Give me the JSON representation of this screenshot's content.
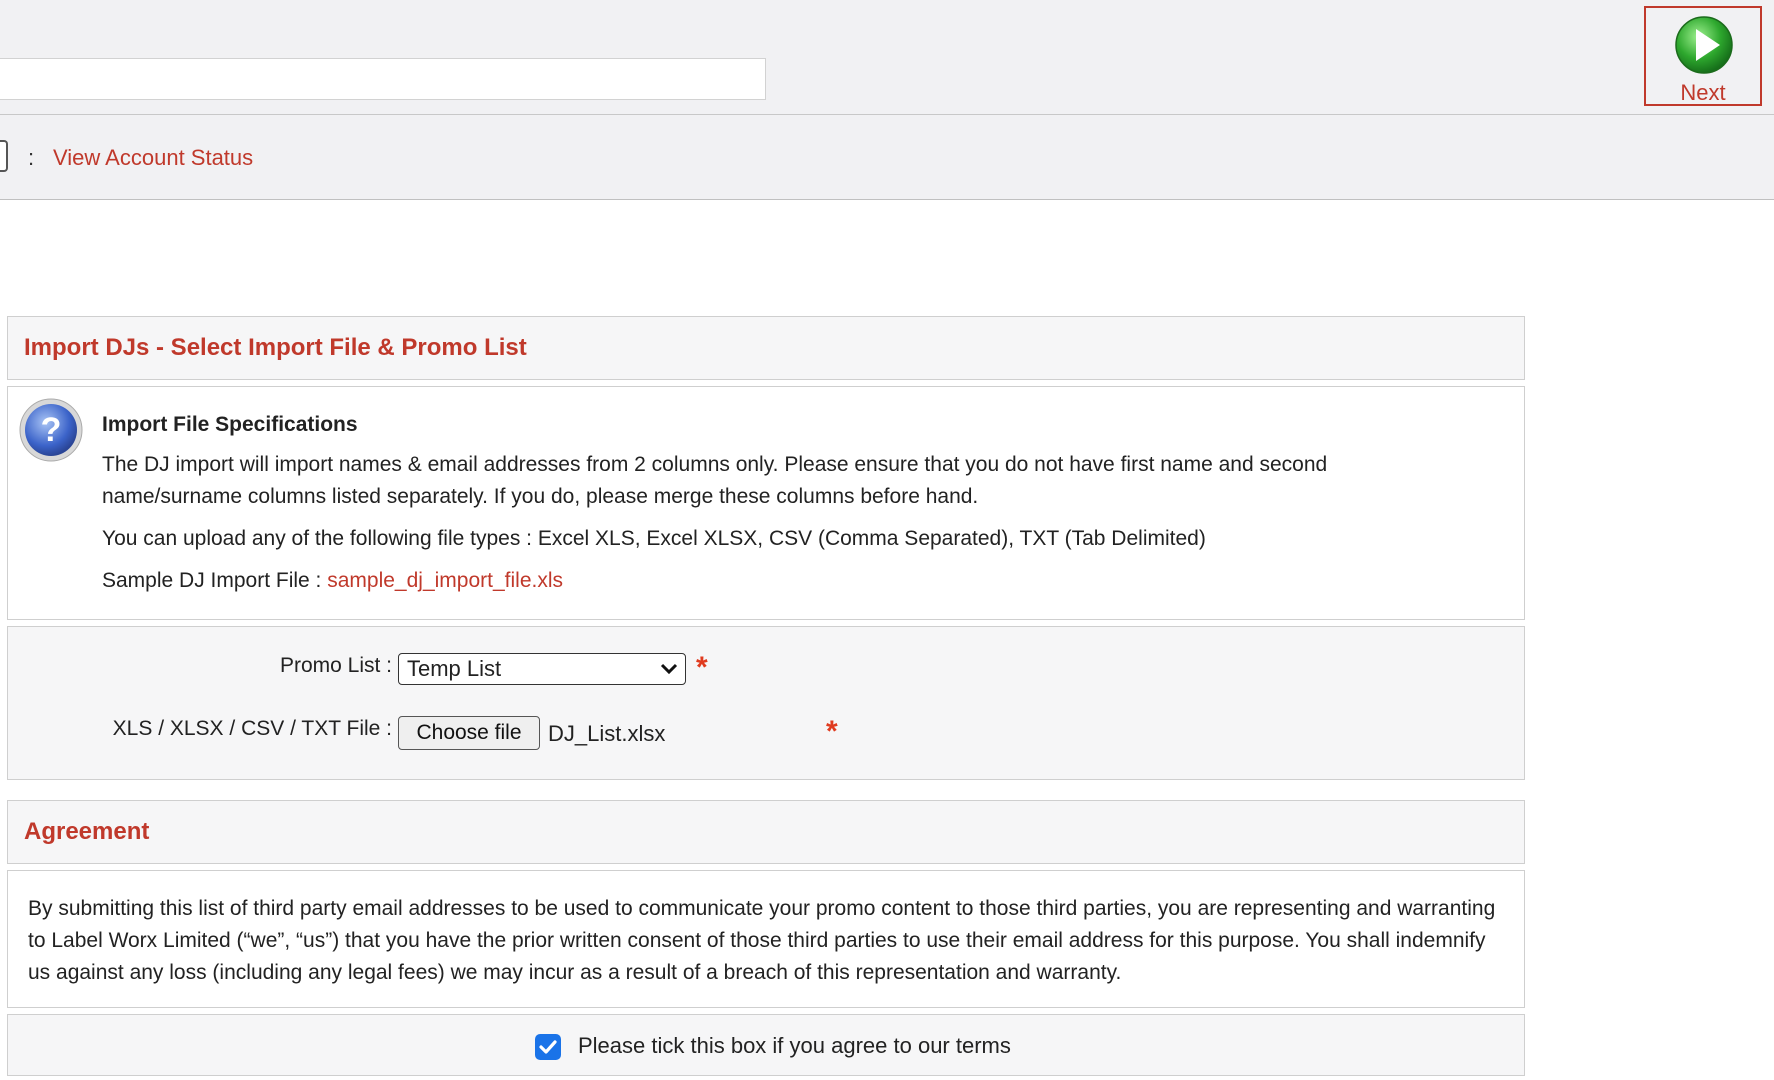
{
  "header": {
    "next_label": "Next"
  },
  "nav": {
    "separator": ":",
    "account_status_link": "View Account Status"
  },
  "import_panel": {
    "title": "Import DJs - Select Import File & Promo List"
  },
  "specs": {
    "title": "Import File Specifications",
    "para1": "The DJ import will import names & email addresses from 2 columns only. Please ensure that you do not have first name and second name/surname columns listed separately. If you do, please merge these columns before hand.",
    "para2": "You can upload any of the following file types : Excel XLS, Excel XLSX, CSV (Comma Separated), TXT (Tab Delimited)",
    "sample_label": "Sample DJ Import File : ",
    "sample_link": "sample_dj_import_file.xls"
  },
  "form": {
    "promo_label": "Promo List :",
    "promo_selected": "Temp List",
    "file_label": "XLS / XLSX / CSV / TXT File :",
    "file_button": "Choose file",
    "file_name": "DJ_List.xlsx",
    "required_mark": "*"
  },
  "agreement": {
    "title": "Agreement",
    "text": "By submitting this list of third party email addresses to be used to communicate your promo content to those third parties, you are representing and warranting to Label Worx Limited (“we”, “us”) that you have the prior written consent of those third parties to use their email address for this purpose. You shall indemnify us against any loss (including any legal fees) we may incur as a result of a breach of this representation and warranty.",
    "checkbox_label": "Please tick this box if you agree to our terms",
    "checked": true
  },
  "colors": {
    "accent": "#c0392b",
    "required": "#e03b1f",
    "checkbox": "#1a73e8",
    "next_icon": "#2ea82e"
  },
  "icons": [
    "play-icon",
    "help-icon",
    "chevron-down-icon",
    "checkmark-icon"
  ]
}
